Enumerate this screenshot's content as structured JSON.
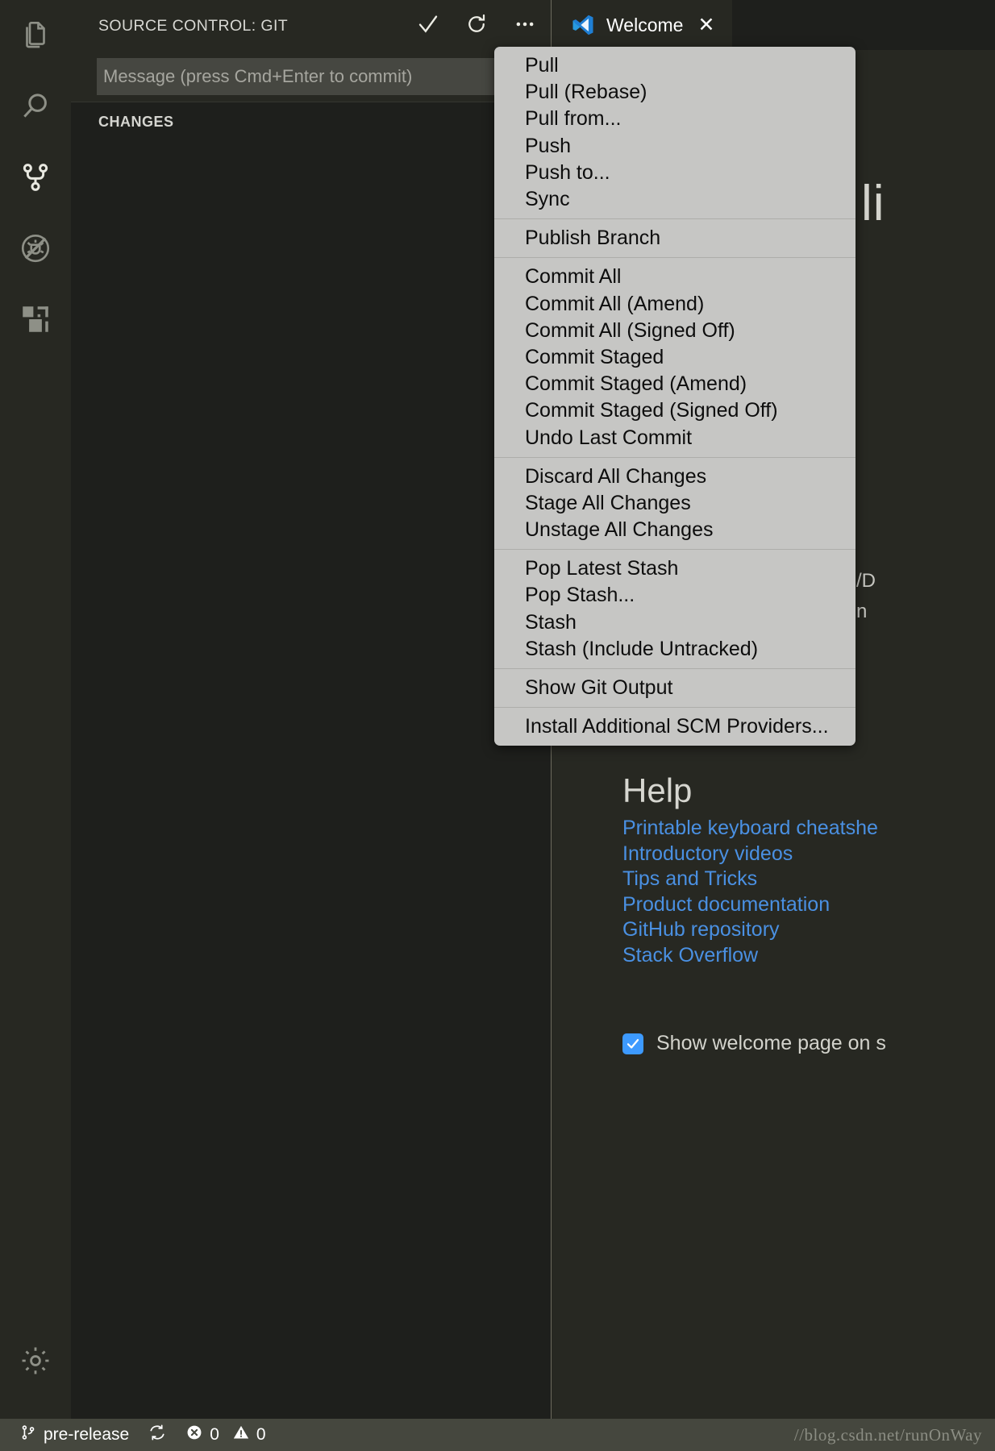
{
  "activity_bar": {
    "items": [
      {
        "name": "explorer",
        "icon": "files-icon",
        "active": false
      },
      {
        "name": "search",
        "icon": "search-icon",
        "active": false
      },
      {
        "name": "source-control",
        "icon": "source-control-icon",
        "active": true
      },
      {
        "name": "run-and-debug",
        "icon": "run-debug-icon",
        "active": false
      },
      {
        "name": "extensions",
        "icon": "extensions-icon",
        "active": false
      }
    ],
    "bottom": [
      {
        "name": "manage",
        "icon": "gear-icon"
      }
    ]
  },
  "sidebar": {
    "title": "SOURCE CONTROL: GIT",
    "actions": [
      {
        "name": "commit",
        "icon": "checkmark-icon",
        "glyph": "✓"
      },
      {
        "name": "refresh",
        "icon": "refresh-icon",
        "glyph": "↻"
      },
      {
        "name": "more-actions",
        "icon": "ellipsis-icon",
        "glyph": "•••"
      }
    ],
    "commit_input": {
      "placeholder": "Message (press Cmd+Enter to commit)",
      "value": ""
    },
    "changes_label": "CHANGES"
  },
  "editor": {
    "tabs": [
      {
        "label": "Welcome",
        "icon": "vscode-logo-icon",
        "close": "✕",
        "active": true
      }
    ],
    "welcome": {
      "title": "li",
      "faint_line_1": "/D",
      "faint_line_2": "n",
      "help_heading": "Help",
      "help_links": [
        "Printable keyboard cheatshe",
        "Introductory videos",
        "Tips and Tricks",
        "Product documentation",
        "GitHub repository",
        "Stack Overflow"
      ],
      "show_welcome": {
        "checked": true,
        "label": "Show welcome page on s"
      }
    }
  },
  "context_menu": {
    "groups": [
      {
        "items": [
          "Pull",
          "Pull (Rebase)",
          "Pull from...",
          "Push",
          "Push to...",
          "Sync"
        ]
      },
      {
        "items": [
          "Publish Branch"
        ]
      },
      {
        "items": [
          "Commit All",
          "Commit All (Amend)",
          "Commit All (Signed Off)",
          "Commit Staged",
          "Commit Staged (Amend)",
          "Commit Staged (Signed Off)",
          "Undo Last Commit"
        ]
      },
      {
        "items": [
          "Discard All Changes",
          "Stage All Changes",
          "Unstage All Changes"
        ]
      },
      {
        "items": [
          "Pop Latest Stash",
          "Pop Stash...",
          "Stash",
          "Stash (Include Untracked)"
        ]
      },
      {
        "items": [
          "Show Git Output"
        ]
      },
      {
        "items": [
          "Install Additional SCM Providers..."
        ]
      }
    ]
  },
  "status_bar": {
    "branch": "pre-release",
    "sync_icon": "sync-icon",
    "errors_count": "0",
    "warnings_count": "0",
    "watermark": "//blog.csdn.net/runOnWay"
  },
  "colors": {
    "accent_blue": "#4a90e2",
    "checkbox_blue": "#3d9aff",
    "status_bar_bg": "#45473e",
    "menu_bg": "#c6c6c4",
    "editor_bg": "#272822",
    "panel_bg": "#1e1f1c"
  }
}
